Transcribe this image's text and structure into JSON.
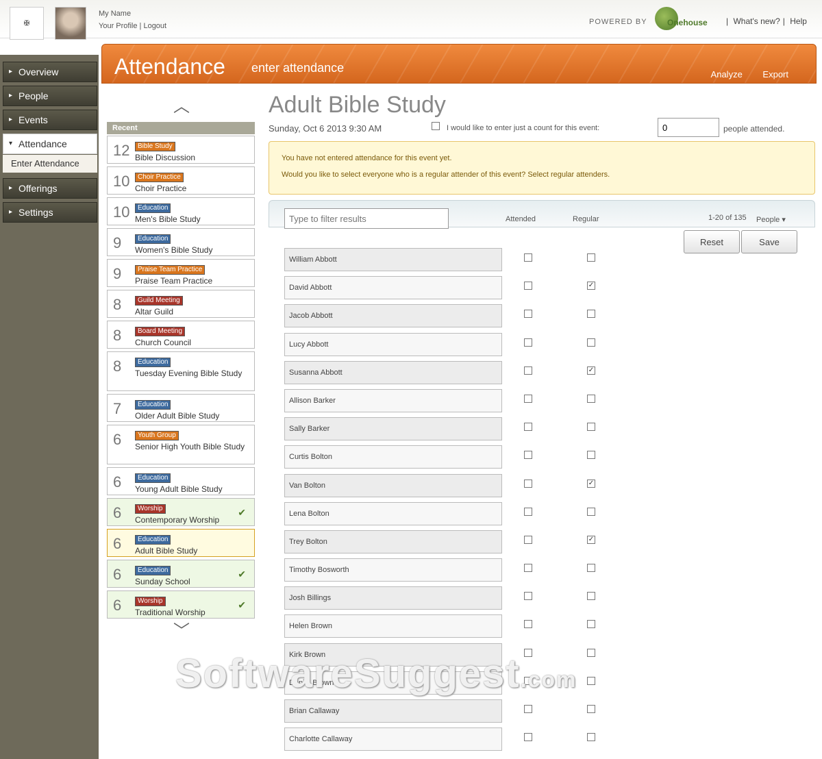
{
  "header": {
    "logo": "",
    "user_name": "My Name",
    "user_links": [
      "Your Profile",
      "Logout"
    ],
    "powered_by": "POWERED BY",
    "brand": "Onehouse",
    "links": [
      "What's new?",
      "Help"
    ]
  },
  "nav": {
    "items": [
      {
        "label": "Overview"
      },
      {
        "label": "People"
      },
      {
        "label": "Events"
      },
      {
        "label": "Attendance"
      },
      {
        "label": "Offerings"
      },
      {
        "label": "Settings"
      }
    ],
    "sub_item": "Enter Attendance"
  },
  "banner": {
    "title": "Attendance",
    "subtitle": "enter attendance",
    "actions": [
      "Analyze",
      "Export"
    ]
  },
  "events": {
    "heading": "Recent",
    "items": [
      {
        "day": "12",
        "tag": "Bible Study",
        "tag_color": "#d9761e",
        "name": "Bible Discussion"
      },
      {
        "day": "10",
        "tag": "Choir Practice",
        "tag_color": "#d9761e",
        "name": "Choir Practice"
      },
      {
        "day": "10",
        "tag": "Education",
        "tag_color": "#3d6a9e",
        "name": "Men's Bible Study"
      },
      {
        "day": "9",
        "tag": "Education",
        "tag_color": "#3d6a9e",
        "name": "Women's Bible Study"
      },
      {
        "day": "9",
        "tag": "Praise Team Practice",
        "tag_color": "#d9761e",
        "name": "Praise Team Practice"
      },
      {
        "day": "8",
        "tag": "Guild Meeting",
        "tag_color": "#a8352a",
        "name": "Altar Guild"
      },
      {
        "day": "8",
        "tag": "Board Meeting",
        "tag_color": "#a8352a",
        "name": "Church Council"
      },
      {
        "day": "8",
        "tag": "Education",
        "tag_color": "#3d6a9e",
        "name": "Tuesday Evening Bible Study"
      },
      {
        "day": "7",
        "tag": "Education",
        "tag_color": "#3d6a9e",
        "name": "Older Adult Bible Study"
      },
      {
        "day": "6",
        "tag": "Youth Group",
        "tag_color": "#d9761e",
        "name": "Senior High Youth Bible Study"
      },
      {
        "day": "6",
        "tag": "Education",
        "tag_color": "#3d6a9e",
        "name": "Young Adult Bible Study"
      },
      {
        "day": "6",
        "tag": "Worship",
        "tag_color": "#a8352a",
        "name": "Contemporary Worship"
      },
      {
        "day": "6",
        "tag": "Education",
        "tag_color": "#3d6a9e",
        "name": "Adult Bible Study"
      },
      {
        "day": "6",
        "tag": "Education",
        "tag_color": "#3d6a9e",
        "name": "Sunday School"
      },
      {
        "day": "6",
        "tag": "Worship",
        "tag_color": "#a8352a",
        "name": "Traditional Worship"
      }
    ]
  },
  "main": {
    "title": "Adult Bible Study",
    "date": "Sunday, Oct 6 2013 9:30 AM",
    "count_label": "I would like to enter just a count for this event:",
    "count_value": "0",
    "count_after": "people attended.",
    "notice": [
      "You have not entered attendance for this event yet.",
      "Would you like to select everyone who is a regular attender of this event? Select regular attenders."
    ],
    "filter_placeholder": "Type to filter results",
    "col_attended": "Attended",
    "col_regular": "Regular",
    "paging": "1-20 of 135",
    "col_people": "People",
    "reset_label": "Reset",
    "save_label": "Save"
  },
  "people": [
    {
      "name": "William Abbott",
      "regular": false
    },
    {
      "name": "David Abbott",
      "regular": true
    },
    {
      "name": "Jacob Abbott",
      "regular": false
    },
    {
      "name": "Lucy Abbott",
      "regular": false
    },
    {
      "name": "Susanna Abbott",
      "regular": true
    },
    {
      "name": "Allison Barker",
      "regular": false
    },
    {
      "name": "Sally Barker",
      "regular": false
    },
    {
      "name": "Curtis Bolton",
      "regular": false
    },
    {
      "name": "Van Bolton",
      "regular": true
    },
    {
      "name": "Lena Bolton",
      "regular": false
    },
    {
      "name": "Trey Bolton",
      "regular": true
    },
    {
      "name": "Timothy Bosworth",
      "regular": false
    },
    {
      "name": "Josh Billings",
      "regular": false
    },
    {
      "name": "Helen Brown",
      "regular": false
    },
    {
      "name": "Kirk Brown",
      "regular": false
    },
    {
      "name": "Daniel Brown",
      "regular": false
    },
    {
      "name": "Brian Callaway",
      "regular": false
    },
    {
      "name": "Charlotte Callaway",
      "regular": false
    }
  ],
  "watermark": "SoftwareSuggest",
  "watermark_suffix": ".com"
}
